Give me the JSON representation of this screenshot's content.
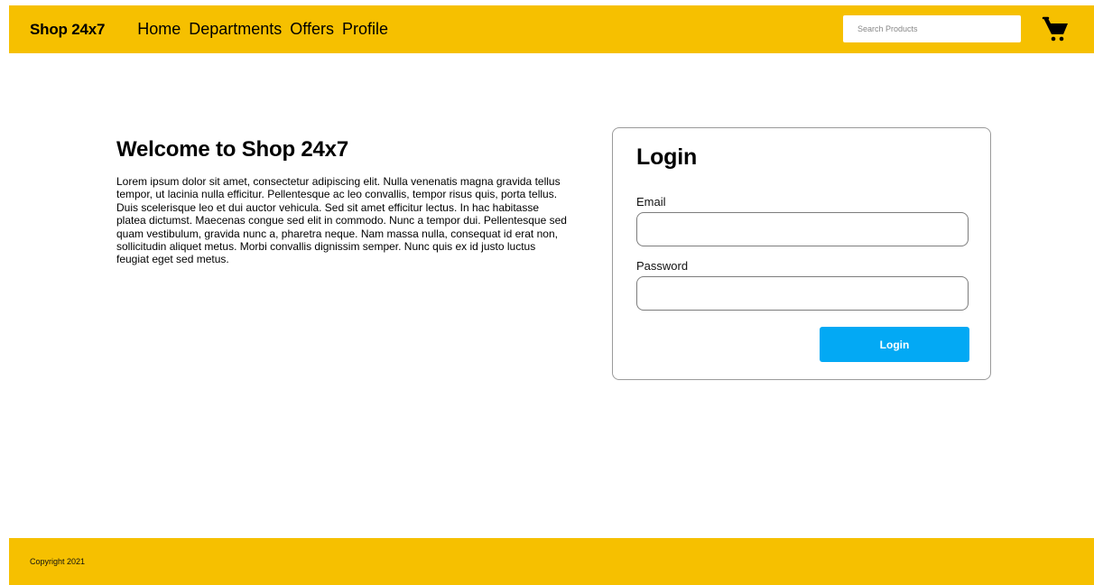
{
  "header": {
    "brand": "Shop 24x7",
    "nav": [
      {
        "label": "Home"
      },
      {
        "label": "Departments"
      },
      {
        "label": "Offers"
      },
      {
        "label": "Profile"
      }
    ],
    "search": {
      "placeholder": "Search Products",
      "value": ""
    },
    "cart_icon": "cart-icon"
  },
  "welcome": {
    "title": "Welcome to Shop 24x7",
    "body": "Lorem ipsum dolor sit amet, consectetur adipiscing elit. Nulla venenatis magna gravida tellus tempor, ut lacinia nulla efficitur. Pellentesque ac leo convallis, tempor risus quis, porta tellus. Duis scelerisque leo et dui auctor vehicula. Sed sit amet efficitur lectus. In hac habitasse platea dictumst. Maecenas congue sed elit in commodo. Nunc a tempor dui. Pellentesque sed quam vestibulum, gravida nunc a, pharetra neque. Nam massa nulla, consequat id erat non, sollicitudin aliquet metus. Morbi convallis dignissim semper. Nunc quis ex id justo luctus feugiat eget sed metus."
  },
  "login": {
    "title": "Login",
    "email_label": "Email",
    "email_value": "",
    "password_label": "Password",
    "password_value": "",
    "button_label": "Login"
  },
  "footer": {
    "copyright": "Copyright 2021"
  },
  "colors": {
    "accent": "#f6c000",
    "button": "#03a9f4"
  }
}
